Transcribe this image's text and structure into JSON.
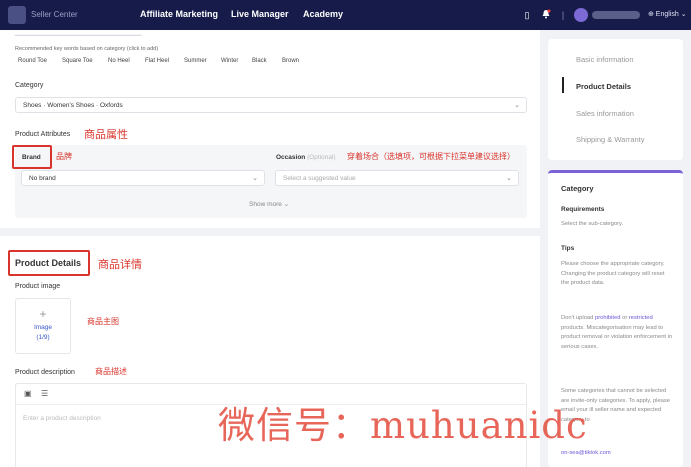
{
  "topbar": {
    "logo_text": "Seller Center",
    "nav": [
      "Affiliate Marketing",
      "Live Manager",
      "Academy"
    ],
    "language": "⊕ English ⌄"
  },
  "keywords": {
    "hint": "Recommended key words based on category (click to add)",
    "items": [
      "Round Toe",
      "Square Toe",
      "No Heel",
      "Flat Heel",
      "Summer",
      "Winter",
      "Black",
      "Brown"
    ]
  },
  "category": {
    "label": "Category",
    "value": "Shoes · Women's Shoes · Oxfords"
  },
  "attributes": {
    "label": "Product Attributes",
    "label_cn": "商品属性",
    "brand_label": "Brand",
    "brand_cn": "品牌",
    "brand_value": "No brand",
    "occasion_label": "Occasion",
    "occasion_optional": "(Optional)",
    "occasion_cn": "穿着场合（选填项，可根据下拉菜单建议选择）",
    "occasion_placeholder": "Select a suggested value",
    "show_more": "Show more ⌄"
  },
  "details": {
    "title": "Product Details",
    "title_cn": "商品详情",
    "image_label": "Product image",
    "image_cn": "商品主图",
    "image_btn": "Image",
    "image_count": "(1/9)",
    "desc_label": "Product description",
    "desc_cn": "商品描述",
    "desc_placeholder": "Enter a product description"
  },
  "steps": [
    "Basic information",
    "Product Details",
    "Sales information",
    "Shipping & Warranty"
  ],
  "tips": {
    "category_title": "Category",
    "requirements_title": "Requirements",
    "requirements_text": "Select the sub-category.",
    "tips_title": "Tips",
    "tips_text": "Please choose the appropriate category. Changing the product category will reset the product data.",
    "upload_1": "Don't upload",
    "upload_prohibited": "prohibited",
    "upload_2": "or",
    "upload_restricted": "restricted",
    "upload_3": "products. Miscategorisation may lead to product removal or violation enforcement in serious cases.",
    "invite_text": "Some categories that cannot be selected are invite-only categories. To apply, please email your ill seller name and expected category to",
    "email": "on-sea@tiktok.com"
  },
  "watermark": "微信号：muhuanidc"
}
